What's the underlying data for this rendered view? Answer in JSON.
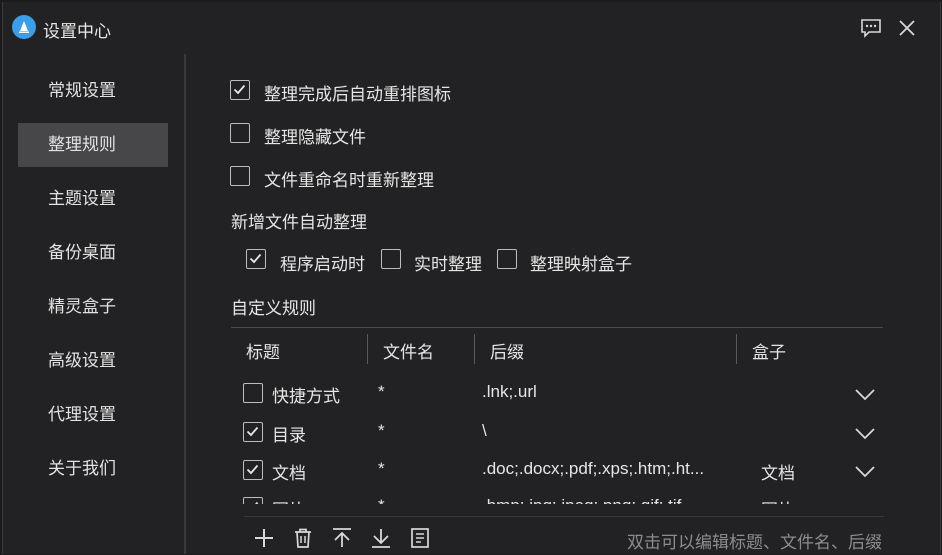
{
  "window": {
    "title": "设置中心"
  },
  "titlebar": {
    "feedback_icon": "chat-bubble-icon",
    "close_icon": "close-icon"
  },
  "sidebar": {
    "items": [
      {
        "label": "常规设置"
      },
      {
        "label": "整理规则"
      },
      {
        "label": "主题设置"
      },
      {
        "label": "备份桌面"
      },
      {
        "label": "精灵盒子"
      },
      {
        "label": "高级设置"
      },
      {
        "label": "代理设置"
      },
      {
        "label": "关于我们"
      }
    ],
    "active_index": 1
  },
  "options": [
    {
      "label": "整理完成后自动重排图标",
      "checked": true
    },
    {
      "label": "整理隐藏文件",
      "checked": false
    },
    {
      "label": "文件重命名时重新整理",
      "checked": false
    }
  ],
  "auto_section": {
    "title": "新增文件自动整理",
    "options": [
      {
        "label": "程序启动时",
        "checked": true
      },
      {
        "label": "实时整理",
        "checked": false
      },
      {
        "label": "整理映射盒子",
        "checked": false
      }
    ]
  },
  "rules": {
    "title": "自定义规则",
    "columns": [
      "标题",
      "文件名",
      "后缀",
      "盒子"
    ],
    "rows": [
      {
        "checked": false,
        "title": "快捷方式",
        "filename": "*",
        "suffix": ".lnk;.url",
        "box": ""
      },
      {
        "checked": true,
        "title": "目录",
        "filename": "*",
        "suffix": "\\",
        "box": ""
      },
      {
        "checked": true,
        "title": "文档",
        "filename": "*",
        "suffix": ".doc;.docx;.pdf;.xps;.htm;.ht...",
        "box": "文档"
      },
      {
        "checked": true,
        "title": "图片",
        "filename": "*",
        "suffix": ".bmp;.jpg;.jpeg;.png;.gif;.tif...",
        "box": "图片"
      }
    ]
  },
  "toolbar": {
    "icons": [
      "add-icon",
      "trash-icon",
      "move-top-icon",
      "move-bottom-icon",
      "notes-icon"
    ],
    "hint": "双击可以编辑标题、文件名、后缀"
  }
}
